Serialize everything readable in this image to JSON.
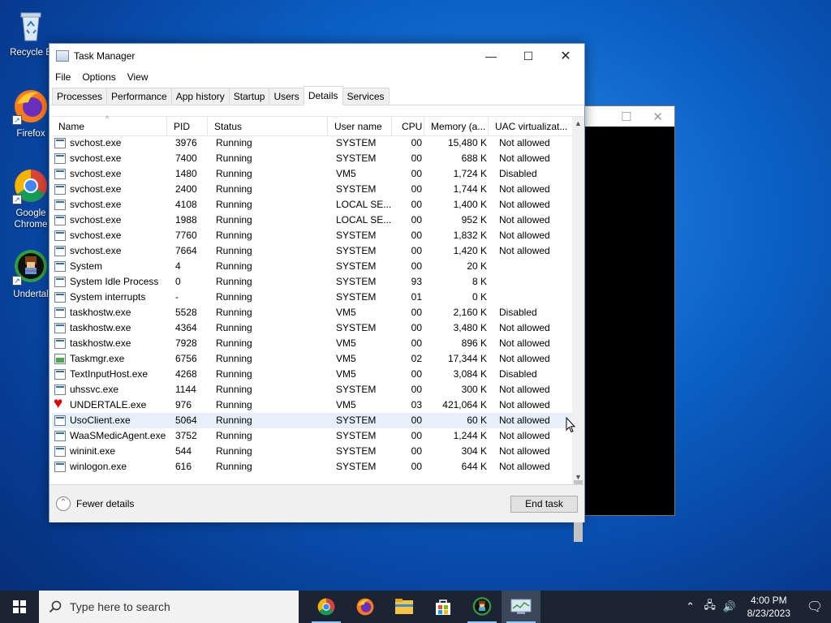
{
  "desktop": {
    "icons": [
      {
        "label": "Recycle Bin",
        "icon": "recycle-bin-icon"
      },
      {
        "label": "Firefox",
        "icon": "firefox-icon"
      },
      {
        "label": "Google Chrome",
        "icon": "chrome-icon"
      },
      {
        "label": "Undertale",
        "icon": "undertale-icon"
      }
    ],
    "icon_labels_visible": [
      "Recycle B",
      "Firefox",
      "Google\nChrome",
      "Undertal"
    ]
  },
  "window": {
    "title": "Task Manager",
    "controls": {
      "minimize": "—",
      "maximize": "☐",
      "close": "✕"
    }
  },
  "menu": [
    "File",
    "Options",
    "View"
  ],
  "tabs": [
    "Processes",
    "Performance",
    "App history",
    "Startup",
    "Users",
    "Details",
    "Services"
  ],
  "active_tab": "Details",
  "table": {
    "columns": [
      "Name",
      "PID",
      "Status",
      "User name",
      "CPU",
      "Memory (a...",
      "UAC virtualizat..."
    ],
    "rows": [
      {
        "name": "svchost.exe",
        "pid": "3976",
        "status": "Running",
        "user": "SYSTEM",
        "cpu": "00",
        "mem": "15,480 K",
        "uac": "Not allowed",
        "icon": "process-icon"
      },
      {
        "name": "svchost.exe",
        "pid": "7400",
        "status": "Running",
        "user": "SYSTEM",
        "cpu": "00",
        "mem": "688 K",
        "uac": "Not allowed",
        "icon": "process-icon"
      },
      {
        "name": "svchost.exe",
        "pid": "1480",
        "status": "Running",
        "user": "VM5",
        "cpu": "00",
        "mem": "1,724 K",
        "uac": "Disabled",
        "icon": "process-icon"
      },
      {
        "name": "svchost.exe",
        "pid": "2400",
        "status": "Running",
        "user": "SYSTEM",
        "cpu": "00",
        "mem": "1,744 K",
        "uac": "Not allowed",
        "icon": "process-icon"
      },
      {
        "name": "svchost.exe",
        "pid": "4108",
        "status": "Running",
        "user": "LOCAL SE...",
        "cpu": "00",
        "mem": "1,400 K",
        "uac": "Not allowed",
        "icon": "process-icon"
      },
      {
        "name": "svchost.exe",
        "pid": "1988",
        "status": "Running",
        "user": "LOCAL SE...",
        "cpu": "00",
        "mem": "952 K",
        "uac": "Not allowed",
        "icon": "process-icon"
      },
      {
        "name": "svchost.exe",
        "pid": "7760",
        "status": "Running",
        "user": "SYSTEM",
        "cpu": "00",
        "mem": "1,832 K",
        "uac": "Not allowed",
        "icon": "process-icon"
      },
      {
        "name": "svchost.exe",
        "pid": "7664",
        "status": "Running",
        "user": "SYSTEM",
        "cpu": "00",
        "mem": "1,420 K",
        "uac": "Not allowed",
        "icon": "process-icon"
      },
      {
        "name": "System",
        "pid": "4",
        "status": "Running",
        "user": "SYSTEM",
        "cpu": "00",
        "mem": "20 K",
        "uac": "",
        "icon": "process-icon"
      },
      {
        "name": "System Idle Process",
        "pid": "0",
        "status": "Running",
        "user": "SYSTEM",
        "cpu": "93",
        "mem": "8 K",
        "uac": "",
        "icon": "process-icon"
      },
      {
        "name": "System interrupts",
        "pid": "-",
        "status": "Running",
        "user": "SYSTEM",
        "cpu": "01",
        "mem": "0 K",
        "uac": "",
        "icon": "process-icon"
      },
      {
        "name": "taskhostw.exe",
        "pid": "5528",
        "status": "Running",
        "user": "VM5",
        "cpu": "00",
        "mem": "2,160 K",
        "uac": "Disabled",
        "icon": "process-icon"
      },
      {
        "name": "taskhostw.exe",
        "pid": "4364",
        "status": "Running",
        "user": "SYSTEM",
        "cpu": "00",
        "mem": "3,480 K",
        "uac": "Not allowed",
        "icon": "process-icon"
      },
      {
        "name": "taskhostw.exe",
        "pid": "7928",
        "status": "Running",
        "user": "VM5",
        "cpu": "00",
        "mem": "896 K",
        "uac": "Not allowed",
        "icon": "process-icon"
      },
      {
        "name": "Taskmgr.exe",
        "pid": "6756",
        "status": "Running",
        "user": "VM5",
        "cpu": "02",
        "mem": "17,344 K",
        "uac": "Not allowed",
        "icon": "task-manager-icon"
      },
      {
        "name": "TextInputHost.exe",
        "pid": "4268",
        "status": "Running",
        "user": "VM5",
        "cpu": "00",
        "mem": "3,084 K",
        "uac": "Disabled",
        "icon": "process-icon"
      },
      {
        "name": "uhssvc.exe",
        "pid": "1144",
        "status": "Running",
        "user": "SYSTEM",
        "cpu": "00",
        "mem": "300 K",
        "uac": "Not allowed",
        "icon": "process-icon"
      },
      {
        "name": "UNDERTALE.exe",
        "pid": "976",
        "status": "Running",
        "user": "VM5",
        "cpu": "03",
        "mem": "421,064 K",
        "uac": "Not allowed",
        "icon": "heart-icon"
      },
      {
        "name": "UsoClient.exe",
        "pid": "5064",
        "status": "Running",
        "user": "SYSTEM",
        "cpu": "00",
        "mem": "60 K",
        "uac": "Not allowed",
        "icon": "process-icon",
        "selected": true
      },
      {
        "name": "WaaSMedicAgent.exe",
        "pid": "3752",
        "status": "Running",
        "user": "SYSTEM",
        "cpu": "00",
        "mem": "1,244 K",
        "uac": "Not allowed",
        "icon": "process-icon"
      },
      {
        "name": "wininit.exe",
        "pid": "544",
        "status": "Running",
        "user": "SYSTEM",
        "cpu": "00",
        "mem": "304 K",
        "uac": "Not allowed",
        "icon": "process-icon"
      },
      {
        "name": "winlogon.exe",
        "pid": "616",
        "status": "Running",
        "user": "SYSTEM",
        "cpu": "00",
        "mem": "644 K",
        "uac": "Not allowed",
        "icon": "process-icon"
      }
    ]
  },
  "footer": {
    "fewer_details": "Fewer details",
    "end_task": "End task"
  },
  "taskbar": {
    "search_placeholder": "Type here to search",
    "apps": [
      "chrome-icon",
      "firefox-icon",
      "file-explorer-icon",
      "store-icon",
      "undertale-icon",
      "task-manager-icon"
    ],
    "time": "4:00 PM",
    "date": "8/23/2023"
  }
}
